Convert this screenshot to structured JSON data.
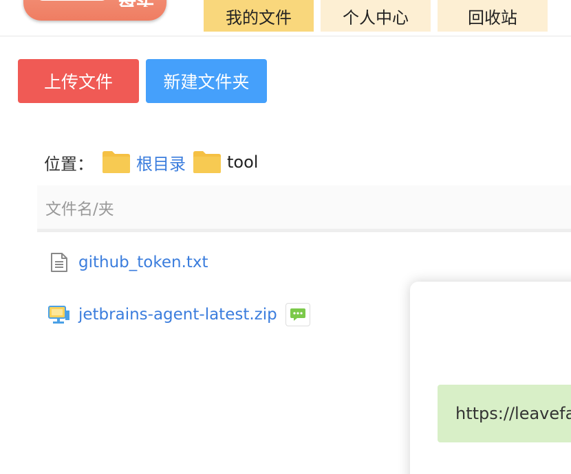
{
  "header": {
    "logo_text": "盘头",
    "tabs": [
      {
        "label": "我的文件",
        "active": true
      },
      {
        "label": "个人中心",
        "active": false
      },
      {
        "label": "回收站",
        "active": false
      }
    ]
  },
  "actions": {
    "upload_label": "上传文件",
    "new_folder_label": "新建文件夹"
  },
  "breadcrumb": {
    "label": "位置：",
    "root": "根目录",
    "current": "tool"
  },
  "table": {
    "column_name": "文件名/夹"
  },
  "files": [
    {
      "name": "github_token.txt",
      "icon": "text-file-icon"
    },
    {
      "name": "jetbrains-agent-latest.zip",
      "icon": "zip-file-icon",
      "has_comment": true
    }
  ],
  "popup": {
    "link_text": "https://leavefa"
  },
  "colors": {
    "tab_active": "#f9d77c",
    "tab_inactive": "#fdefd3",
    "upload_button": "#f05a55",
    "new_folder_button": "#45a0fb",
    "link": "#3b7ddd",
    "folder": "#f5c043",
    "popup_link_bg": "#d8efc7"
  }
}
